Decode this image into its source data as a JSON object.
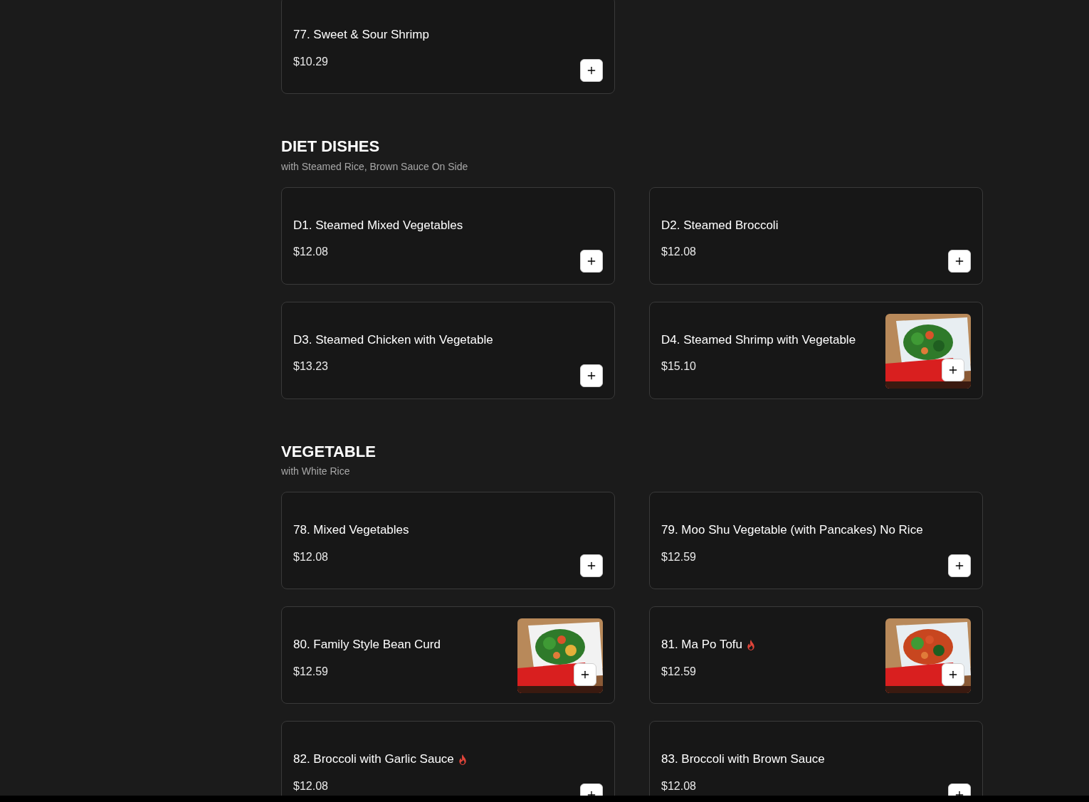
{
  "sections": [
    {
      "items": [
        {
          "name": "77. Sweet & Sour Shrimp",
          "price": "$10.29",
          "spicy": false
        }
      ]
    },
    {
      "title": "DIET DISHES",
      "subtitle": "with Steamed Rice, Brown Sauce On Side",
      "items": [
        {
          "name": "D1. Steamed Mixed Vegetables",
          "price": "$12.08",
          "spicy": false
        },
        {
          "name": "D2. Steamed Broccoli",
          "price": "$12.08",
          "spicy": false
        },
        {
          "name": "D3. Steamed Chicken with Vegetable",
          "price": "$13.23",
          "spicy": false
        },
        {
          "name": "D4. Steamed Shrimp with Vegetable",
          "price": "$15.10",
          "spicy": false
        }
      ]
    },
    {
      "title": "VEGETABLE",
      "subtitle": "with White Rice",
      "items": [
        {
          "name": "78. Mixed Vegetables",
          "price": "$12.08",
          "spicy": false
        },
        {
          "name": "79. Moo Shu Vegetable (with Pancakes) No Rice",
          "price": "$12.59",
          "spicy": false
        },
        {
          "name": "80. Family Style Bean Curd",
          "price": "$12.59",
          "spicy": false
        },
        {
          "name": "81. Ma Po Tofu",
          "price": "$12.59",
          "spicy": true
        },
        {
          "name": "82. Broccoli with Garlic Sauce",
          "price": "$12.08",
          "spicy": true
        },
        {
          "name": "83. Broccoli with Brown Sauce",
          "price": "$12.08",
          "spicy": false
        }
      ]
    }
  ]
}
